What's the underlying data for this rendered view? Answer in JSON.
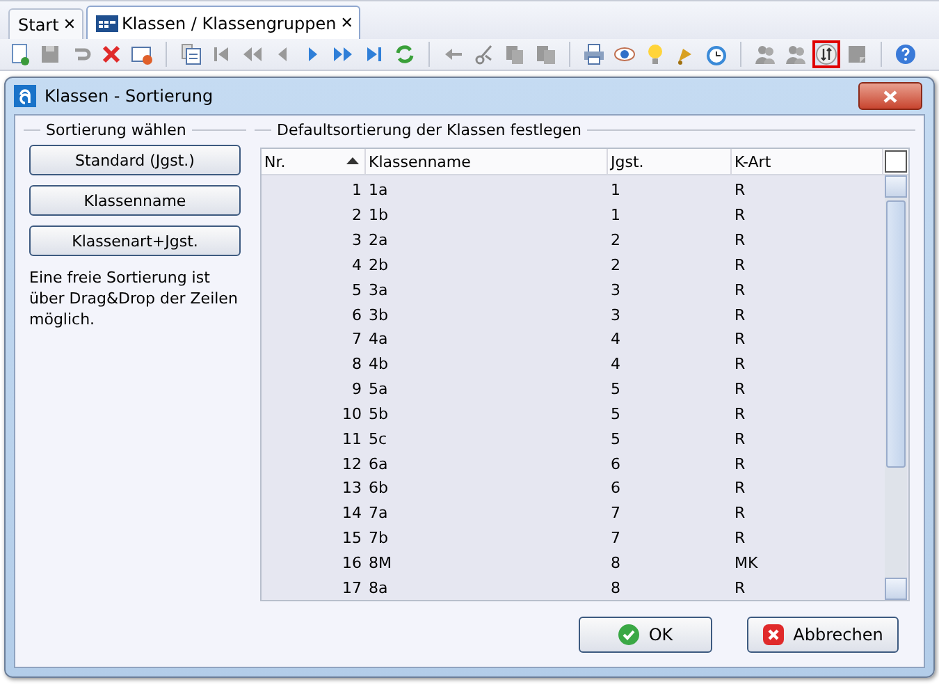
{
  "tabs": [
    {
      "label": "Start",
      "selected": false,
      "close": "✕"
    },
    {
      "label": "Klassen / Klassengruppen",
      "selected": true,
      "close": "✕"
    }
  ],
  "toolbar": [
    {
      "selected": false
    },
    {
      "selected": false
    },
    {
      "selected": false
    },
    {
      "selected": false
    },
    {
      "selected": false
    },
    {
      "selected": false
    },
    {
      "selected": false
    },
    {
      "selected": false
    },
    {
      "selected": false
    },
    {
      "selected": false
    },
    {
      "selected": false
    },
    {
      "selected": false
    },
    {
      "selected": false
    },
    {
      "selected": false
    },
    {
      "selected": false
    },
    {
      "selected": false
    },
    {
      "selected": false
    },
    {
      "selected": false
    },
    {
      "selected": false
    },
    {
      "selected": false
    },
    {
      "selected": false
    },
    {
      "selected": false
    },
    {
      "selected": false
    },
    {
      "selected": false
    },
    {
      "selected": true
    },
    {
      "selected": false
    },
    {
      "selected": false
    }
  ],
  "dialog": {
    "title": "Klassen - Sortierung",
    "left_group": {
      "title": "Sortierung wählen",
      "buttons": [
        "Standard (Jgst.)",
        "Klassenname",
        "Klassenart+Jgst."
      ],
      "note": "Eine freie Sortierung ist über Drag&Drop der Zeilen möglich."
    },
    "right_group": {
      "title": "Defaultsortierung der Klassen festlegen",
      "table": {
        "columns": [
          {
            "label": "Nr.",
            "sorted": true
          },
          {
            "label": "Klassenname",
            "sorted": false
          },
          {
            "label": "Jgst.",
            "sorted": false
          },
          {
            "label": "K-Art",
            "sorted": false
          }
        ],
        "rows": [
          [
            "1",
            "1a",
            "1",
            "R"
          ],
          [
            "2",
            "1b",
            "1",
            "R"
          ],
          [
            "3",
            "2a",
            "2",
            "R"
          ],
          [
            "4",
            "2b",
            "2",
            "R"
          ],
          [
            "5",
            "3a",
            "3",
            "R"
          ],
          [
            "6",
            "3b",
            "3",
            "R"
          ],
          [
            "7",
            "4a",
            "4",
            "R"
          ],
          [
            "8",
            "4b",
            "4",
            "R"
          ],
          [
            "9",
            "5a",
            "5",
            "R"
          ],
          [
            "10",
            "5b",
            "5",
            "R"
          ],
          [
            "11",
            "5c",
            "5",
            "R"
          ],
          [
            "12",
            "6a",
            "6",
            "R"
          ],
          [
            "13",
            "6b",
            "6",
            "R"
          ],
          [
            "14",
            "7a",
            "7",
            "R"
          ],
          [
            "15",
            "7b",
            "7",
            "R"
          ],
          [
            "16",
            "8M",
            "8",
            "MK"
          ],
          [
            "17",
            "8a",
            "8",
            "R"
          ]
        ]
      }
    },
    "buttons": [
      {
        "kind": "ok",
        "label": "OK"
      },
      {
        "kind": "cancel",
        "label": "Abbrechen"
      }
    ]
  }
}
